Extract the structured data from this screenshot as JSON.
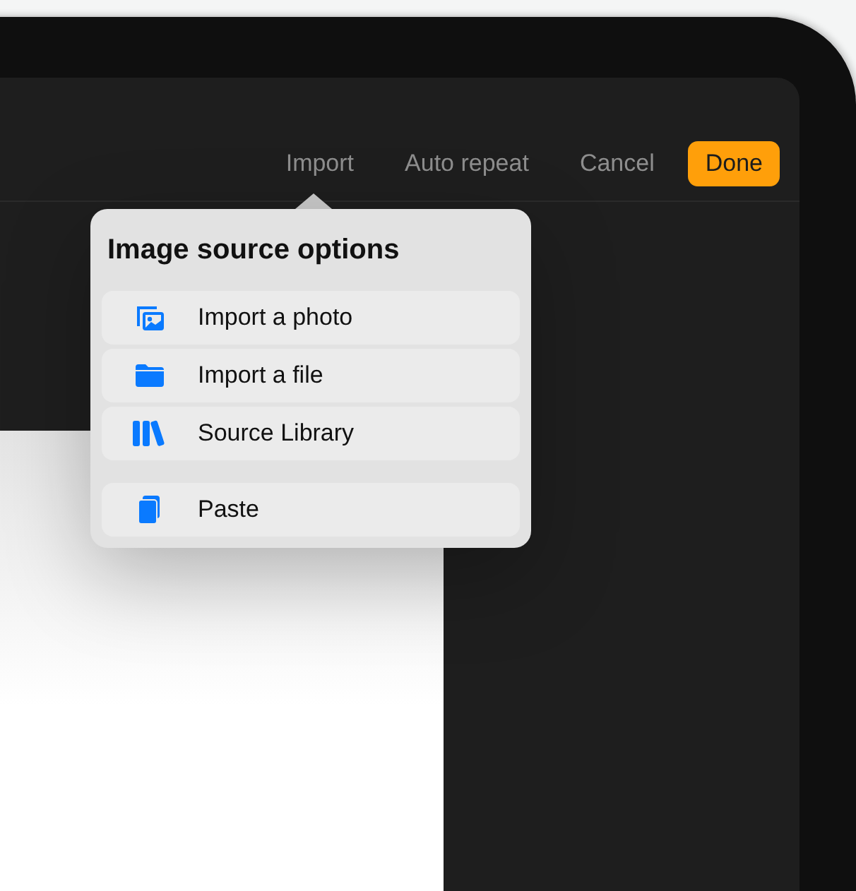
{
  "toolbar": {
    "buttons": [
      {
        "label": "Import",
        "kind": "plain"
      },
      {
        "label": "Auto repeat",
        "kind": "plain"
      },
      {
        "label": "Cancel",
        "kind": "plain"
      },
      {
        "label": "Done",
        "kind": "primary"
      }
    ]
  },
  "popover": {
    "title": "Image source options",
    "groups": [
      [
        {
          "label": "Import a photo"
        },
        {
          "label": "Import a file"
        },
        {
          "label": "Source Library"
        }
      ],
      [
        {
          "label": "Paste"
        }
      ]
    ]
  }
}
